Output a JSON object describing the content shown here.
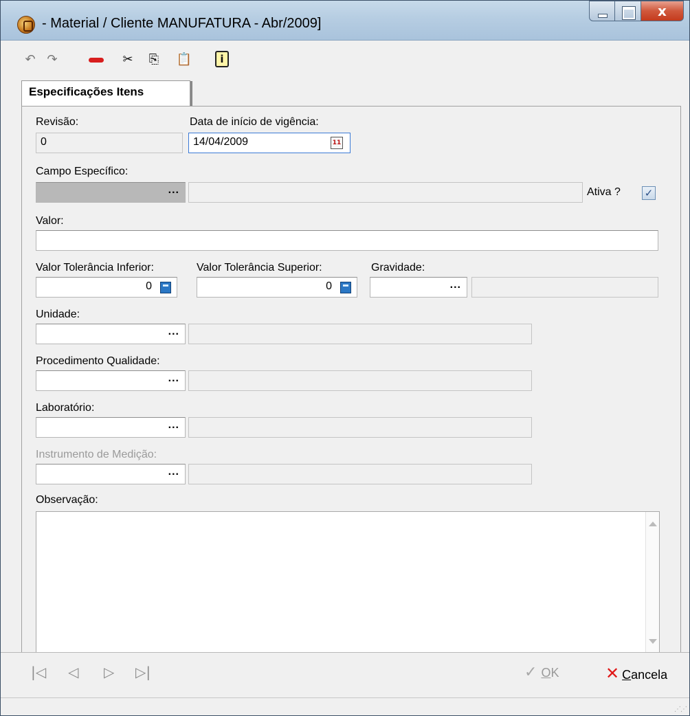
{
  "window": {
    "title": "- Material / Cliente MANUFATURA - Abr/2009]",
    "close_glyph": "x"
  },
  "toolbar": {
    "icons": [
      "undo-icon",
      "redo-icon",
      "stop-icon",
      "cut-icon",
      "copy-icon",
      "paste-icon",
      "info-icon"
    ]
  },
  "tab": {
    "label": "Especificações Itens"
  },
  "form": {
    "revisao_label": "Revisão:",
    "revisao_value": "0",
    "data_label": "Data de início de vigência:",
    "data_value": "14/04/2009",
    "campo_label": "Campo Específico:",
    "ativa_label": "Ativa ?",
    "ativa_checked": true,
    "valor_label": "Valor:",
    "valor_value": "",
    "tol_inf_label": "Valor Tolerância Inferior:",
    "tol_inf_value": "0",
    "tol_sup_label": "Valor Tolerância Superior:",
    "tol_sup_value": "0",
    "gravidade_label": "Gravidade:",
    "unidade_label": "Unidade:",
    "procedimento_label": "Procedimento Qualidade:",
    "laboratorio_label": "Laboratório:",
    "instrumento_label": "Instrumento de Medição:",
    "observacao_label": "Observação:",
    "ellipsis": "...",
    "calendar_glyph": "11"
  },
  "nav": {
    "first": "|◁",
    "prev": "◁",
    "next": "▷",
    "last": "▷|"
  },
  "actions": {
    "ok_underlined": "O",
    "ok_rest": "K",
    "cancel_underlined": "C",
    "cancel_rest": "ancela"
  }
}
